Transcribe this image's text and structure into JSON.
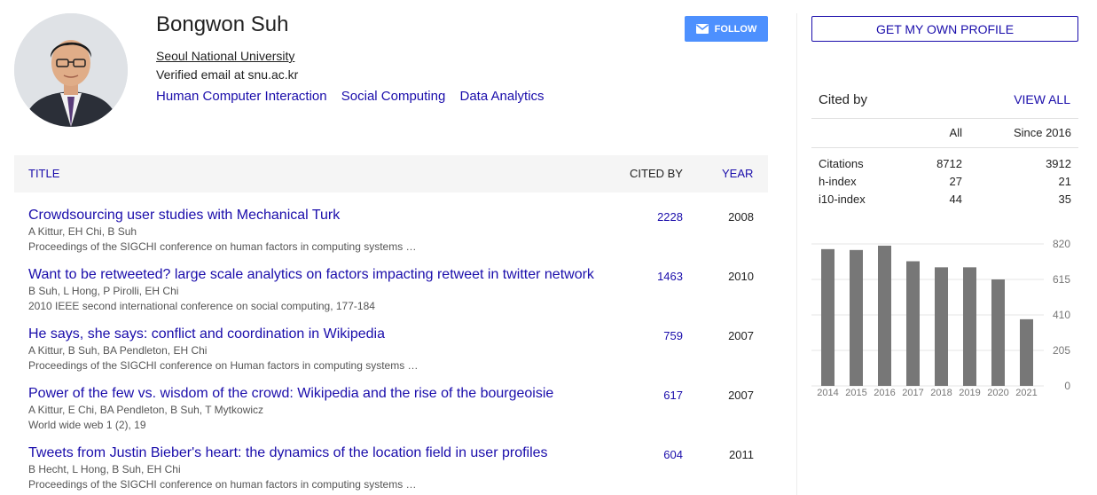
{
  "profile": {
    "name": "Bongwon Suh",
    "affiliation": "Seoul National University",
    "email": "Verified email at snu.ac.kr",
    "interests": [
      "Human Computer Interaction",
      "Social Computing",
      "Data Analytics"
    ],
    "follow_label": "FOLLOW"
  },
  "table": {
    "header": {
      "title": "TITLE",
      "cited_by": "CITED BY",
      "year": "YEAR"
    },
    "rows": [
      {
        "title": "Crowdsourcing user studies with Mechanical Turk",
        "authors": "A Kittur, EH Chi, B Suh",
        "venue": "Proceedings of the SIGCHI conference on human factors in computing systems …",
        "cited": "2228",
        "year": "2008"
      },
      {
        "title": "Want to be retweeted? large scale analytics on factors impacting retweet in twitter network",
        "authors": "B Suh, L Hong, P Pirolli, EH Chi",
        "venue": "2010 IEEE second international conference on social computing, 177-184",
        "cited": "1463",
        "year": "2010"
      },
      {
        "title": "He says, she says: conflict and coordination in Wikipedia",
        "authors": "A Kittur, B Suh, BA Pendleton, EH Chi",
        "venue": "Proceedings of the SIGCHI conference on Human factors in computing systems …",
        "cited": "759",
        "year": "2007"
      },
      {
        "title": "Power of the few vs. wisdom of the crowd: Wikipedia and the rise of the bourgeoisie",
        "authors": "A Kittur, E Chi, BA Pendleton, B Suh, T Mytkowicz",
        "venue": "World wide web 1 (2), 19",
        "cited": "617",
        "year": "2007"
      },
      {
        "title": "Tweets from Justin Bieber's heart: the dynamics of the location field in user profiles",
        "authors": "B Hecht, L Hong, B Suh, EH Chi",
        "venue": "Proceedings of the SIGCHI conference on human factors in computing systems …",
        "cited": "604",
        "year": "2011"
      }
    ]
  },
  "sidebar": {
    "get_profile_label": "GET MY OWN PROFILE",
    "cited_by_label": "Cited by",
    "view_all_label": "VIEW ALL",
    "col_all": "All",
    "col_since": "Since 2016",
    "stats": [
      {
        "label": "Citations",
        "all": "8712",
        "since": "3912"
      },
      {
        "label": "h-index",
        "all": "27",
        "since": "21"
      },
      {
        "label": "i10-index",
        "all": "44",
        "since": "35"
      }
    ]
  },
  "colors": {
    "link": "#1a0dab",
    "follow_bg": "#4d90fe",
    "bar": "#777777"
  },
  "icons": {
    "follow": "envelope-icon"
  },
  "chart_data": {
    "type": "bar",
    "categories": [
      "2014",
      "2015",
      "2016",
      "2017",
      "2018",
      "2019",
      "2020",
      "2021"
    ],
    "values": [
      790,
      785,
      810,
      720,
      685,
      685,
      615,
      385
    ],
    "yticks": [
      "820",
      "615",
      "410",
      "205",
      "0"
    ],
    "ylim": [
      0,
      820
    ],
    "grid": true,
    "title": "",
    "xlabel": "",
    "ylabel": ""
  }
}
